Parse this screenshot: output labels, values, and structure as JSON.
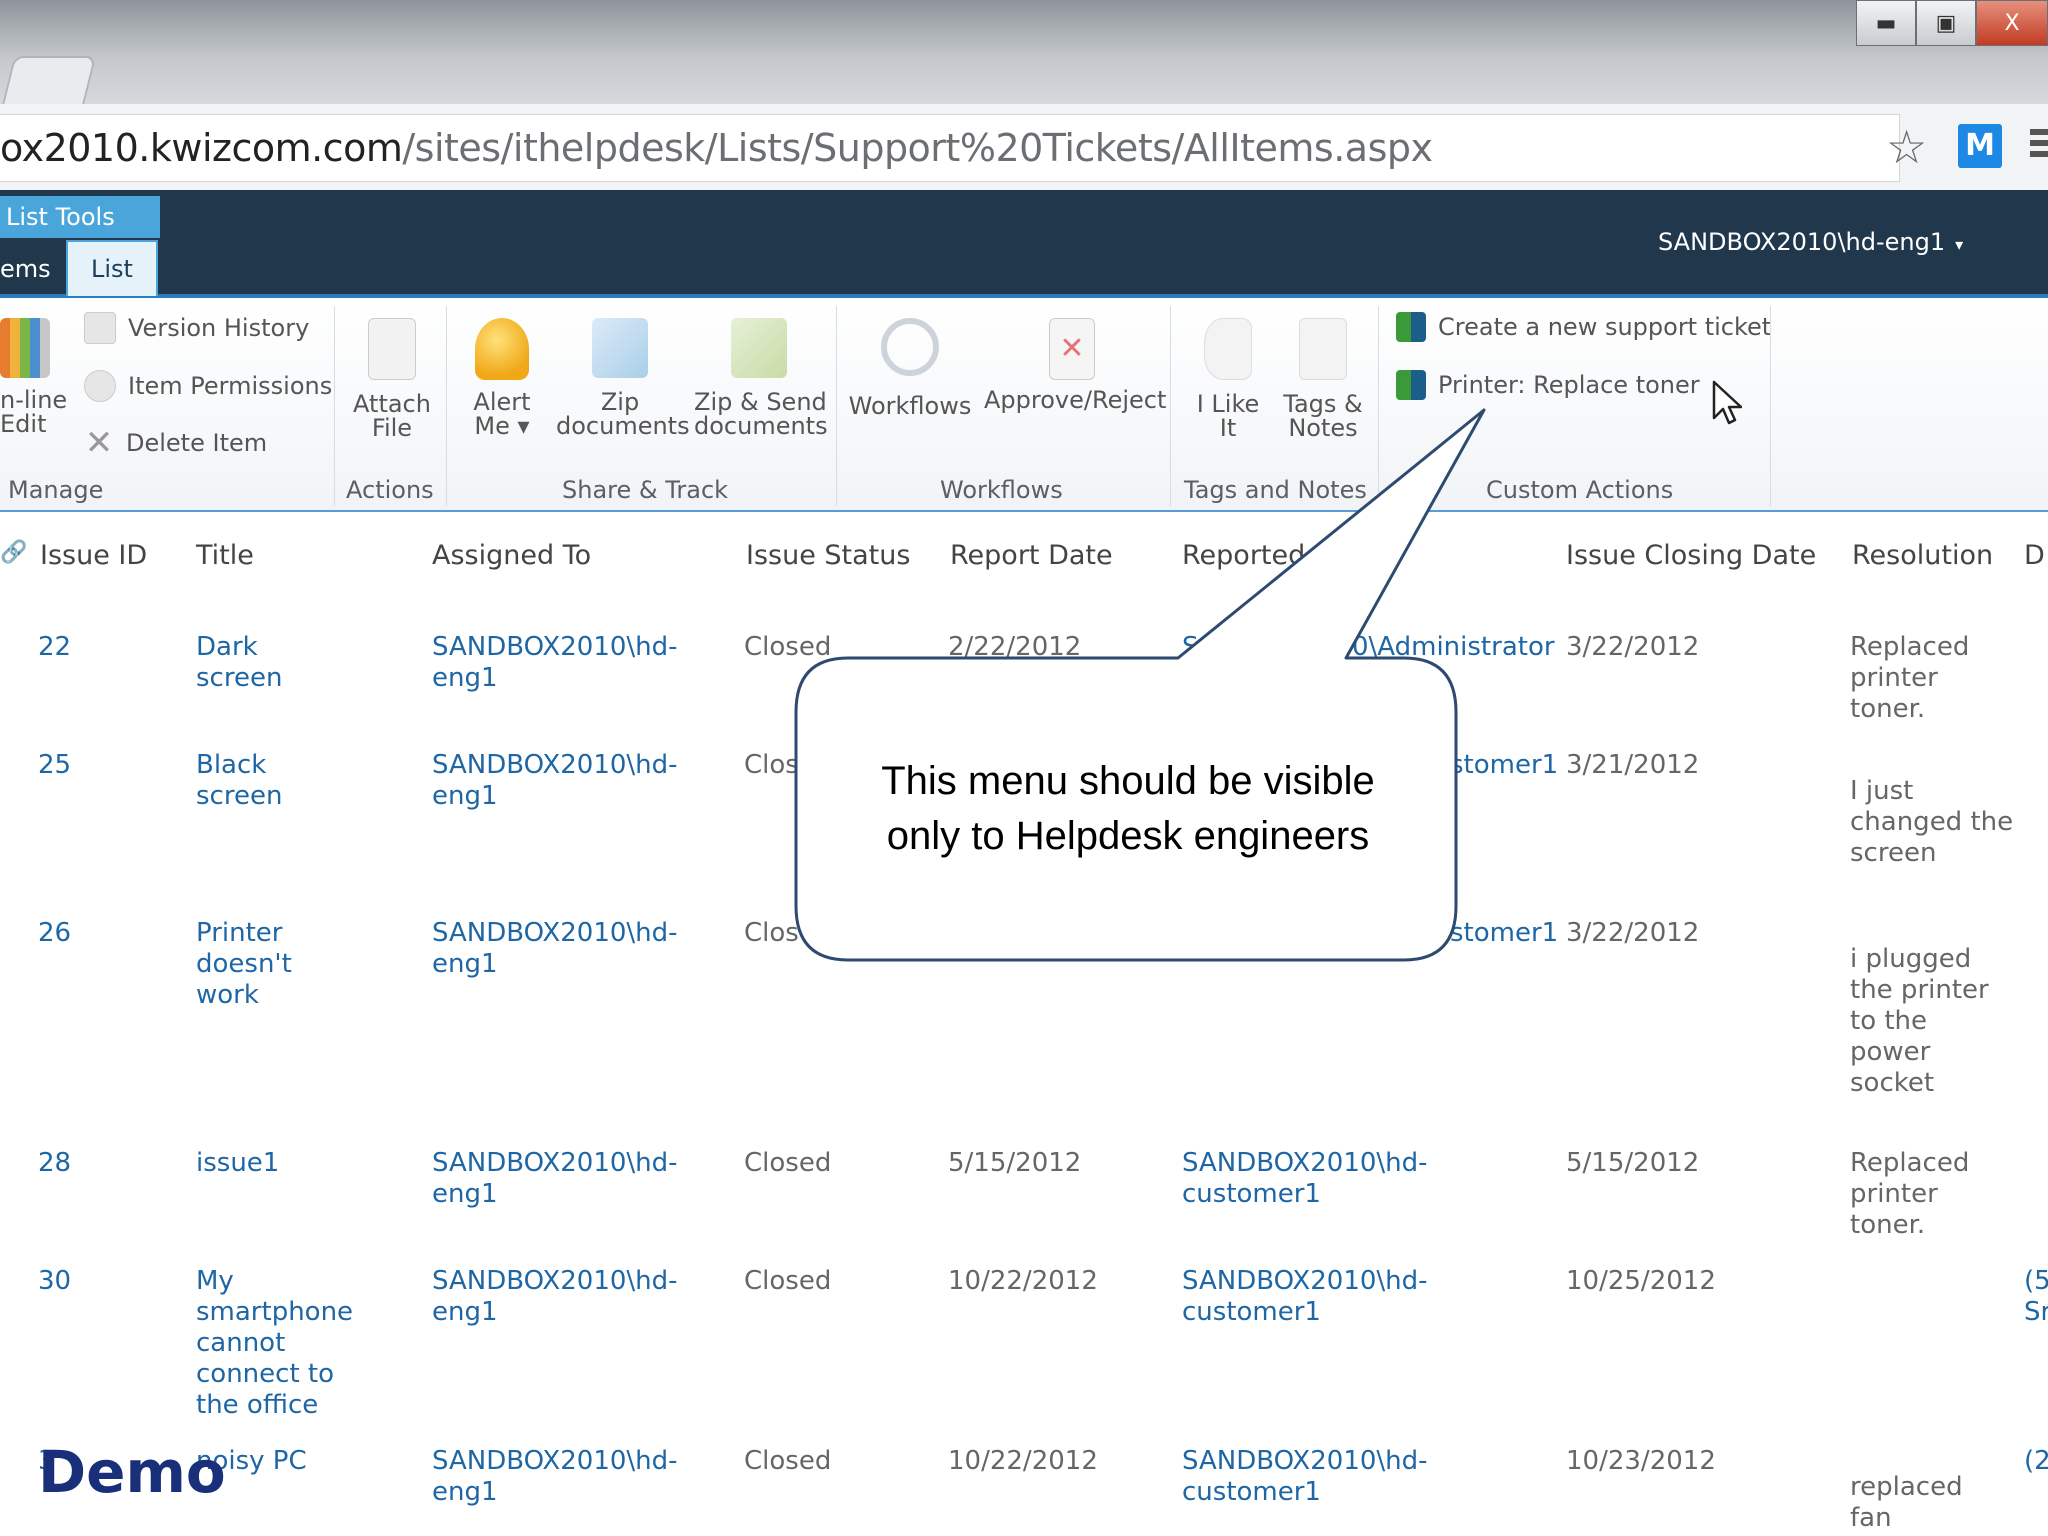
{
  "browser": {
    "url_host": "ox2010.kwizcom.com",
    "url_path": "/sites/ithelpdesk/Lists/Support%20Tickets/AllItems.aspx",
    "ext_label": "M",
    "win_minimize": "▬",
    "win_maximize": "▣",
    "win_close": "X"
  },
  "sp": {
    "context_group": "List Tools",
    "tabs": [
      "ems",
      "List"
    ],
    "user": "SANDBOX2010\\hd-eng1",
    "user_caret": "▾"
  },
  "ribbon": {
    "manage": {
      "inline_edit": "n-line\nEdit",
      "version_history": "Version History",
      "item_permissions": "Item Permissions",
      "delete_item": "Delete Item",
      "label": "Manage"
    },
    "actions": {
      "attach_file": "Attach\nFile",
      "label": "Actions"
    },
    "share_track": {
      "alert_me": "Alert\nMe ▾",
      "zip_documents": "Zip\ndocuments",
      "zip_send": "Zip & Send\ndocuments",
      "label": "Share & Track"
    },
    "workflows": {
      "workflows": "Workflows",
      "approve_reject": "Approve/Reject",
      "label": "Workflows"
    },
    "tags_notes": {
      "i_like_it": "I Like\nIt",
      "tags_notes": "Tags &\nNotes",
      "label": "Tags and Notes"
    },
    "custom_actions": {
      "create_ticket": "Create a new support ticket",
      "replace_toner": "Printer: Replace toner",
      "label": "Custom Actions"
    }
  },
  "table": {
    "headers": {
      "attach": "🔗",
      "issue_id": "Issue ID",
      "title": "Title",
      "assigned_to": "Assigned To",
      "issue_status": "Issue Status",
      "report_date": "Report Date",
      "reported_by": "Reported",
      "closing_date": "Issue Closing Date",
      "resolution": "Resolution",
      "extra": "D"
    },
    "rows": [
      {
        "id": "22",
        "title": "Dark\nscreen",
        "assigned": "SANDBOX2010\\hd-eng1",
        "status": "Closed",
        "report_date": "2/22/2012",
        "reported_by": "S",
        "reporter_tail": "0\\Administrator",
        "closing": "3/22/2012",
        "resolution": "Replaced\nprinter\ntoner.",
        "extra": ""
      },
      {
        "id": "25",
        "title": "Black\nscreen",
        "assigned": "SANDBOX2010\\hd-eng1",
        "status": "Clos",
        "report_date": "",
        "reported_by": "",
        "reporter_tail": "stomer1",
        "closing": "3/21/2012",
        "resolution": "I just\nchanged the\nscreen",
        "extra": ""
      },
      {
        "id": "26",
        "title": "Printer\ndoesn't\nwork",
        "assigned": "SANDBOX2010\\hd-eng1",
        "status": "Clos",
        "report_date": "",
        "reported_by": "",
        "reporter_tail": "stomer1",
        "closing": "3/22/2012",
        "resolution": "i plugged\nthe printer\nto the\npower\nsocket",
        "extra": ""
      },
      {
        "id": "28",
        "title": "issue1",
        "assigned": "SANDBOX2010\\hd-eng1",
        "status": "Closed",
        "report_date": "5/15/2012",
        "reported_by": "SANDBOX2010\\hd-customer1",
        "reporter_tail": "",
        "closing": "5/15/2012",
        "resolution": "Replaced\nprinter\ntoner.",
        "extra": ""
      },
      {
        "id": "30",
        "title": "My\nsmartphone\ncannot\nconnect to\nthe office",
        "assigned": "SANDBOX2010\\hd-eng1",
        "status": "Closed",
        "report_date": "10/22/2012",
        "reported_by": "SANDBOX2010\\hd-customer1",
        "reporter_tail": "",
        "closing": "10/25/2012",
        "resolution": "",
        "extra": "(5\nSr"
      },
      {
        "id": "3",
        "title": "noisy PC",
        "assigned": "SANDBOX2010\\hd-eng1",
        "status": "Closed",
        "report_date": "10/22/2012",
        "reported_by": "SANDBOX2010\\hd-customer1",
        "reporter_tail": "",
        "closing": "10/23/2012",
        "resolution": "replaced\nfan",
        "extra": "(2"
      }
    ]
  },
  "callout": {
    "line1": "This menu should be visible",
    "line2": "only to Helpdesk engineers"
  },
  "overlay": {
    "demo": "Demo"
  },
  "icons": {
    "star": "star-icon",
    "cursor": "mouse-pointer-icon",
    "accent": "#4aa6da",
    "topbar": "#21374c"
  }
}
